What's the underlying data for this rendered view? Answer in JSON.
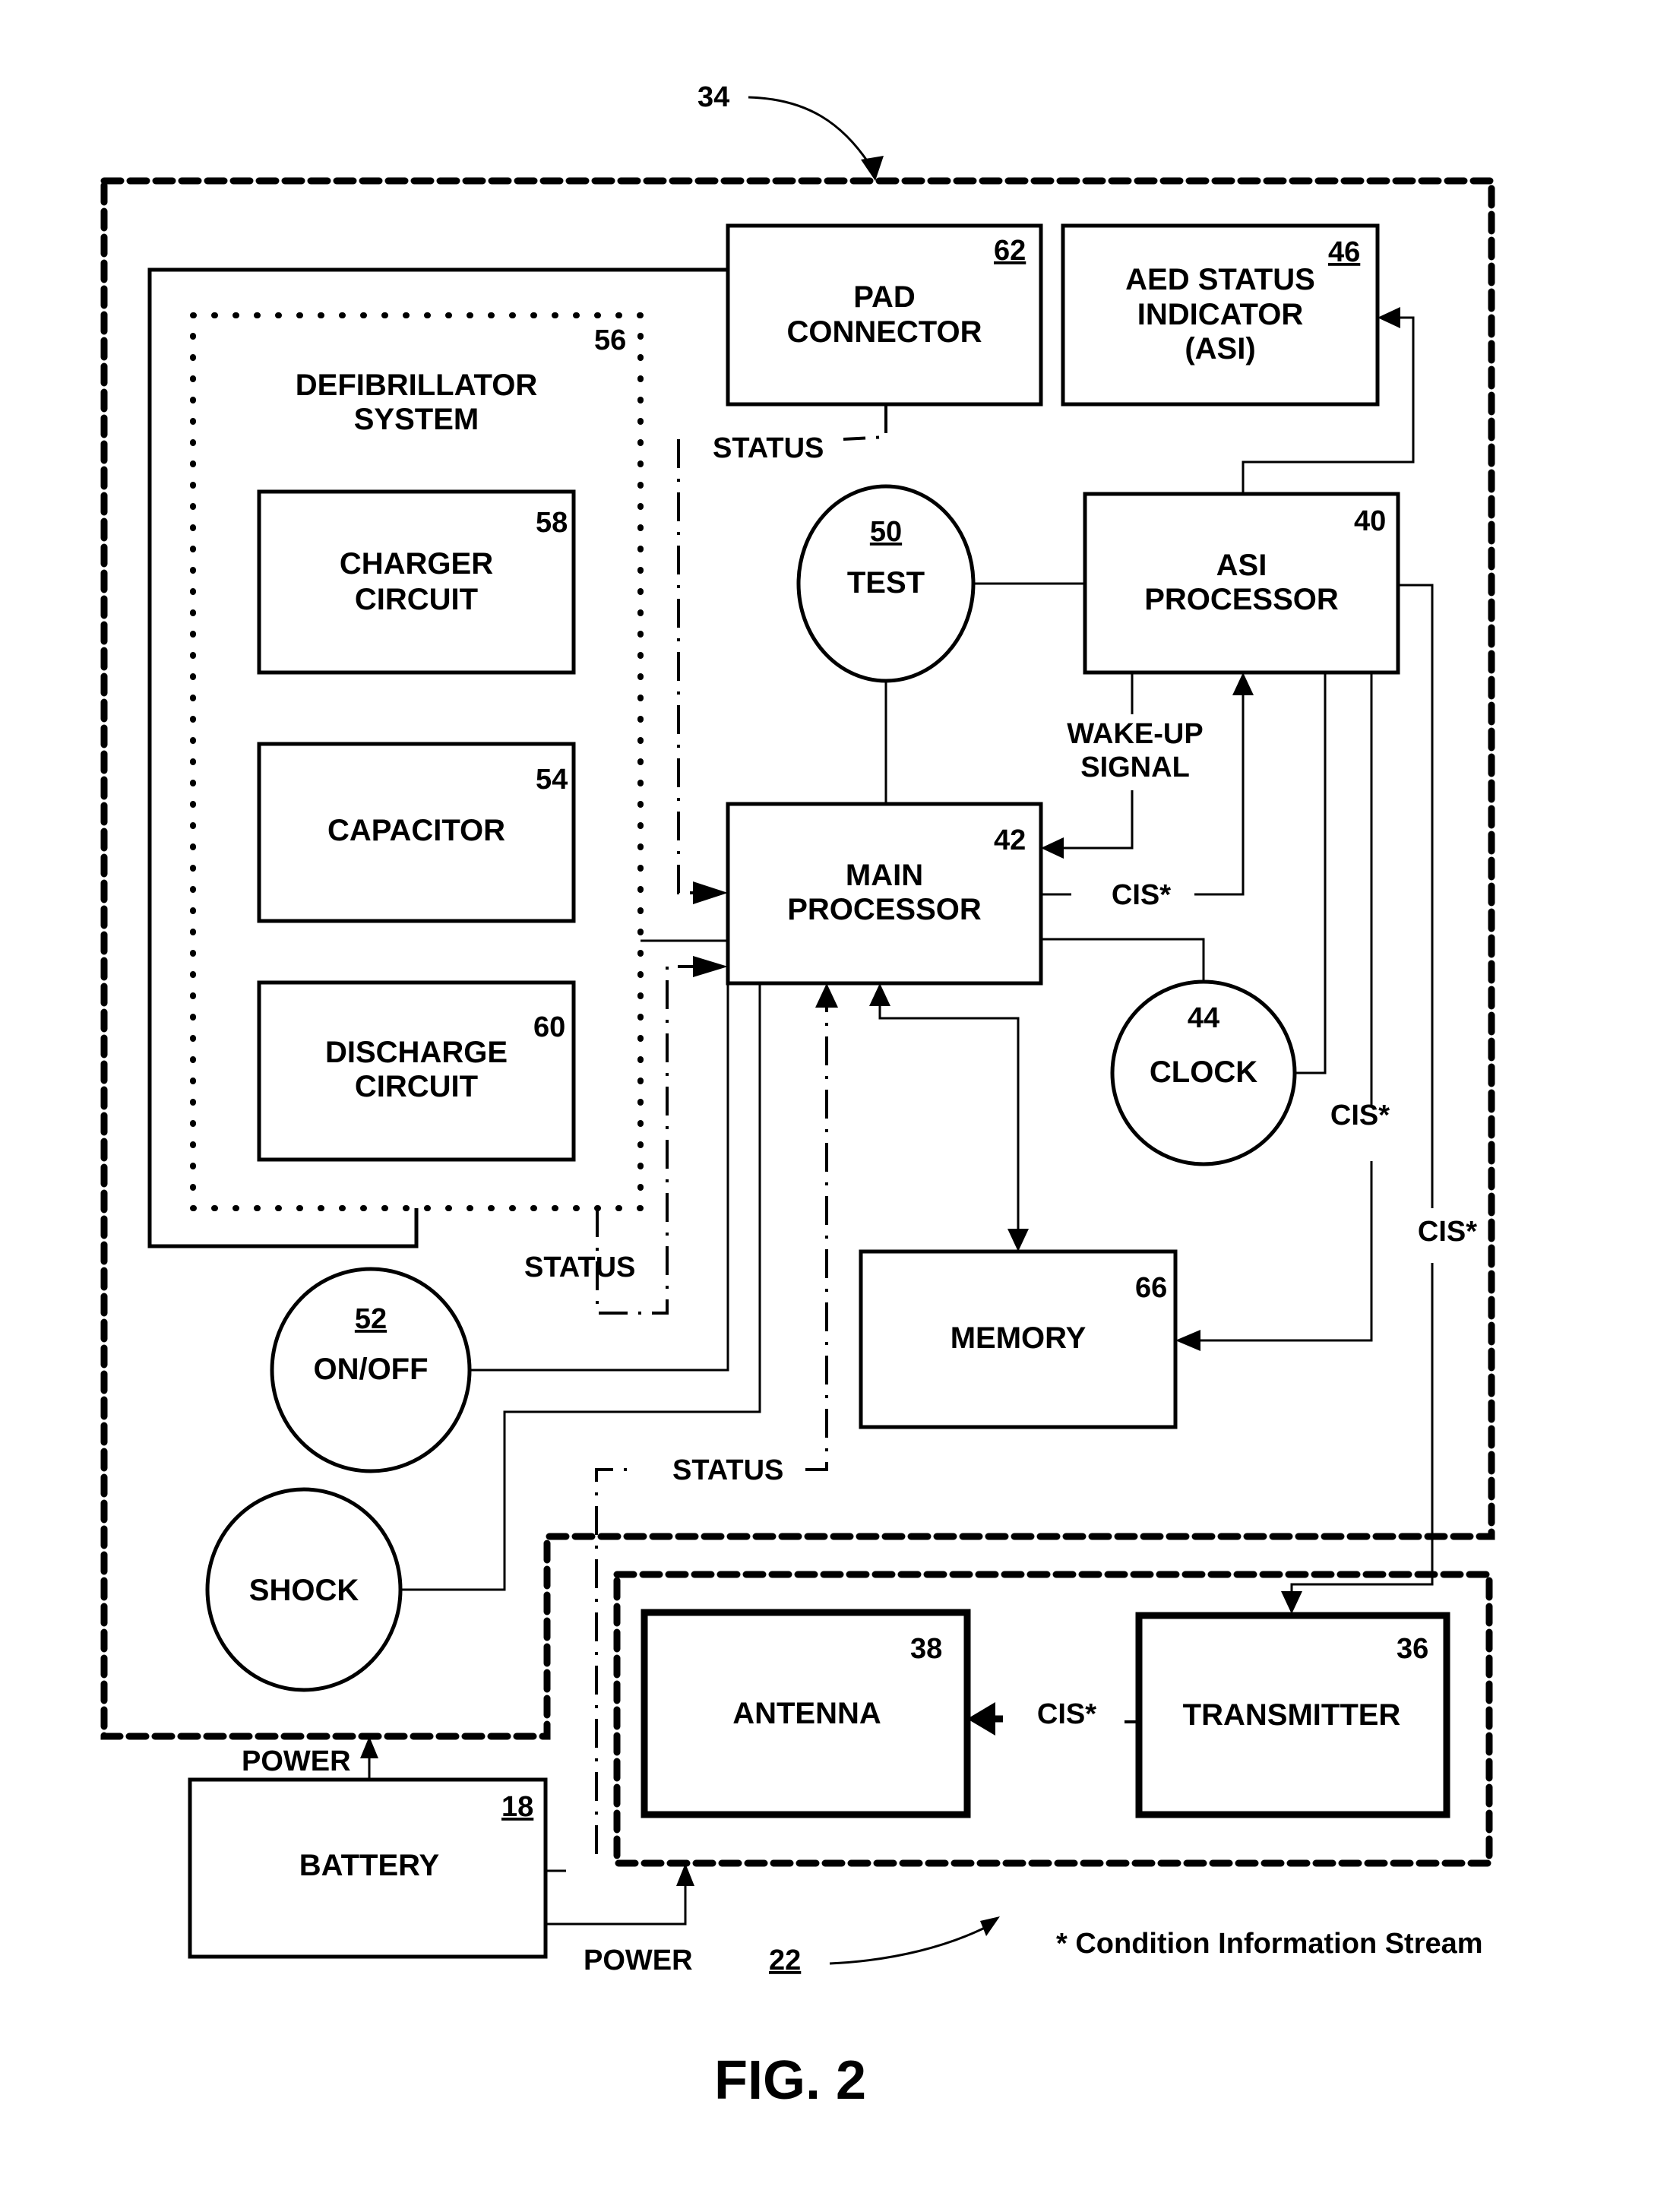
{
  "figure": {
    "caption": "FIG. 2",
    "footnote": "* Condition Information Stream"
  },
  "groups": {
    "aed_unit": {
      "ref": "34"
    },
    "communication_module": {
      "ref": "22"
    },
    "defibrillator_system": {
      "ref": "56",
      "label_line1": "DEFIBRILLATOR",
      "label_line2": "SYSTEM"
    }
  },
  "blocks": {
    "pad_connector": {
      "ref": "62",
      "line1": "PAD",
      "line2": "CONNECTOR"
    },
    "aed_status_indicator": {
      "ref": "46",
      "line1": "AED STATUS",
      "line2": "INDICATOR",
      "line3": "(ASI)"
    },
    "charger_circuit": {
      "ref": "58",
      "line1": "CHARGER",
      "line2": "CIRCUIT"
    },
    "capacitor": {
      "ref": "54",
      "line1": "CAPACITOR"
    },
    "discharge_circuit": {
      "ref": "60",
      "line1": "DISCHARGE",
      "line2": "CIRCUIT"
    },
    "asi_processor": {
      "ref": "40",
      "line1": "ASI",
      "line2": "PROCESSOR"
    },
    "main_processor": {
      "ref": "42",
      "line1": "MAIN",
      "line2": "PROCESSOR"
    },
    "memory": {
      "ref": "66",
      "line1": "MEMORY"
    },
    "antenna": {
      "ref": "38",
      "line1": "ANTENNA"
    },
    "transmitter": {
      "ref": "36",
      "line1": "TRANSMITTER"
    },
    "battery": {
      "ref": "18",
      "line1": "BATTERY"
    }
  },
  "circles": {
    "test": {
      "ref": "50",
      "label": "TEST"
    },
    "clock": {
      "ref": "44",
      "label": "CLOCK"
    },
    "on_off": {
      "ref": "52",
      "label": "ON/OFF"
    },
    "shock": {
      "label": "SHOCK"
    }
  },
  "signals": {
    "status_pad": "STATUS",
    "status_defib": "STATUS",
    "status_comm": "STATUS",
    "wake_up_line1": "WAKE-UP",
    "wake_up_line2": "SIGNAL",
    "cis_main_to_asi": "CIS*",
    "cis_asi_to_memory": "CIS*",
    "cis_asi_to_transmitter": "CIS*",
    "cis_transmitter_to_antenna": "CIS*",
    "power_to_aed": "POWER",
    "power_to_comm": "POWER"
  }
}
